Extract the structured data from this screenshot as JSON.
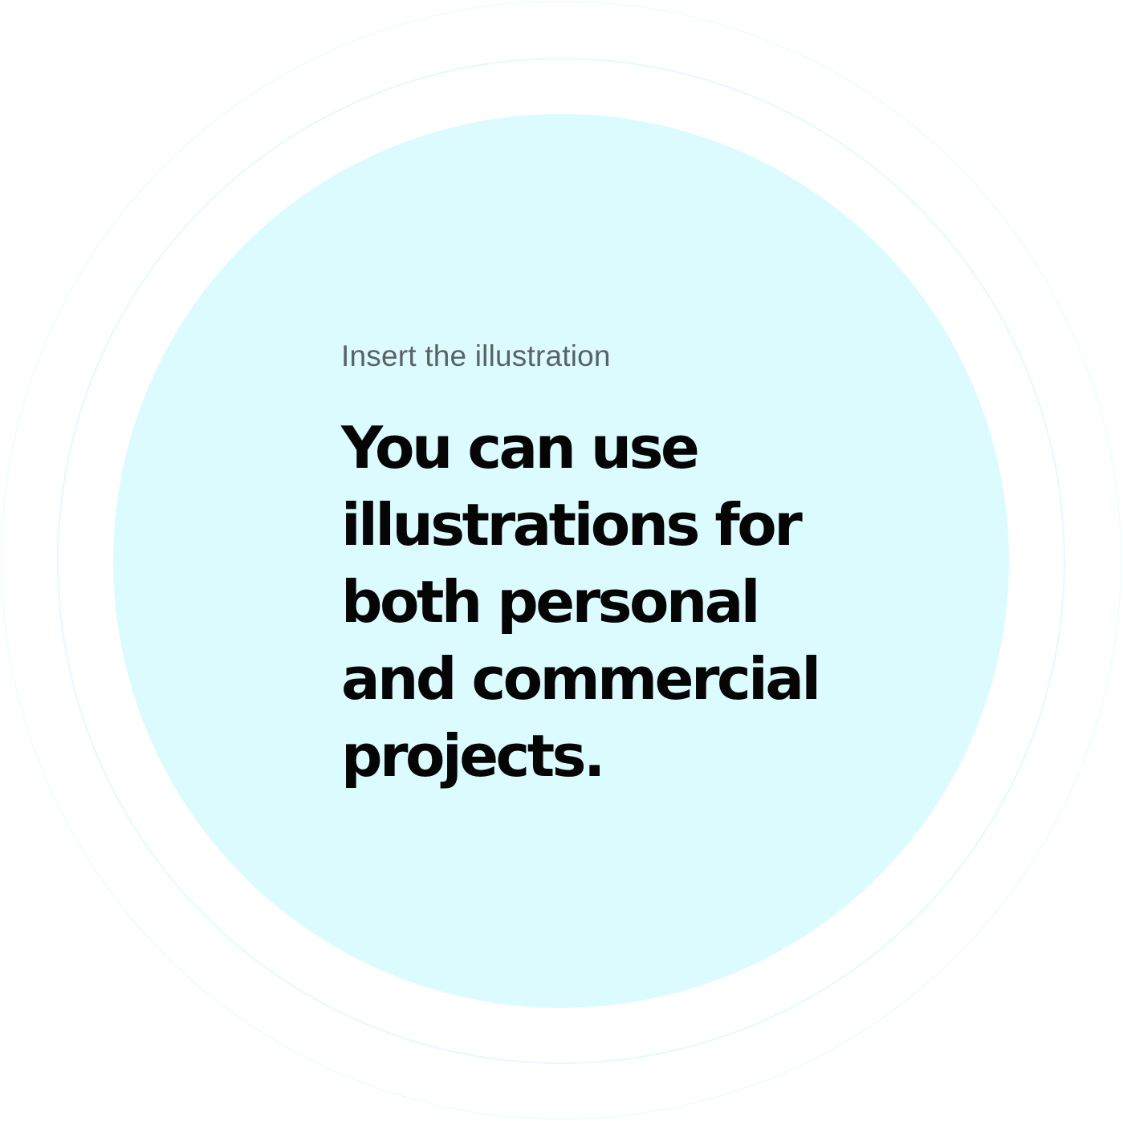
{
  "eyebrow": "Insert the illustration",
  "headline": {
    "lines": [
      "You can use",
      "illustrations for",
      "both personal",
      "and commercial",
      "projects."
    ]
  },
  "colors": {
    "background": "#ffffff",
    "disc": "#dcfbfe",
    "ring": "#e3fafd",
    "eyebrow_text": "#5a6266",
    "headline_text": "#050505"
  }
}
